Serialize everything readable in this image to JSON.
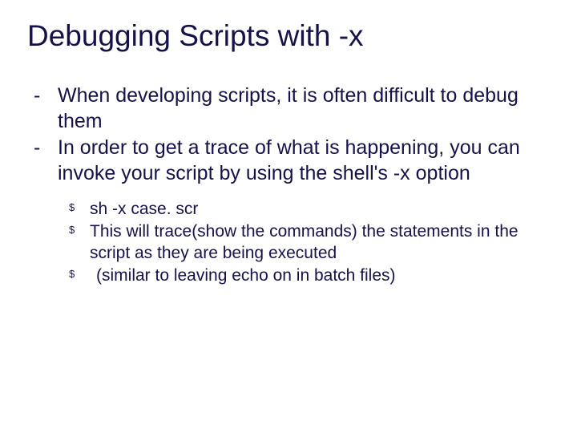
{
  "title": "Debugging Scripts with -x",
  "bullets": [
    "When developing scripts, it is often difficult to debug them",
    "In order to get a trace of what is happening, you can invoke your script by using the shell's -x option"
  ],
  "subbullets": [
    "sh -x case. scr",
    "This will trace(show the commands) the statements in the script as they are being executed",
    " (similar to leaving echo on in batch files)"
  ]
}
